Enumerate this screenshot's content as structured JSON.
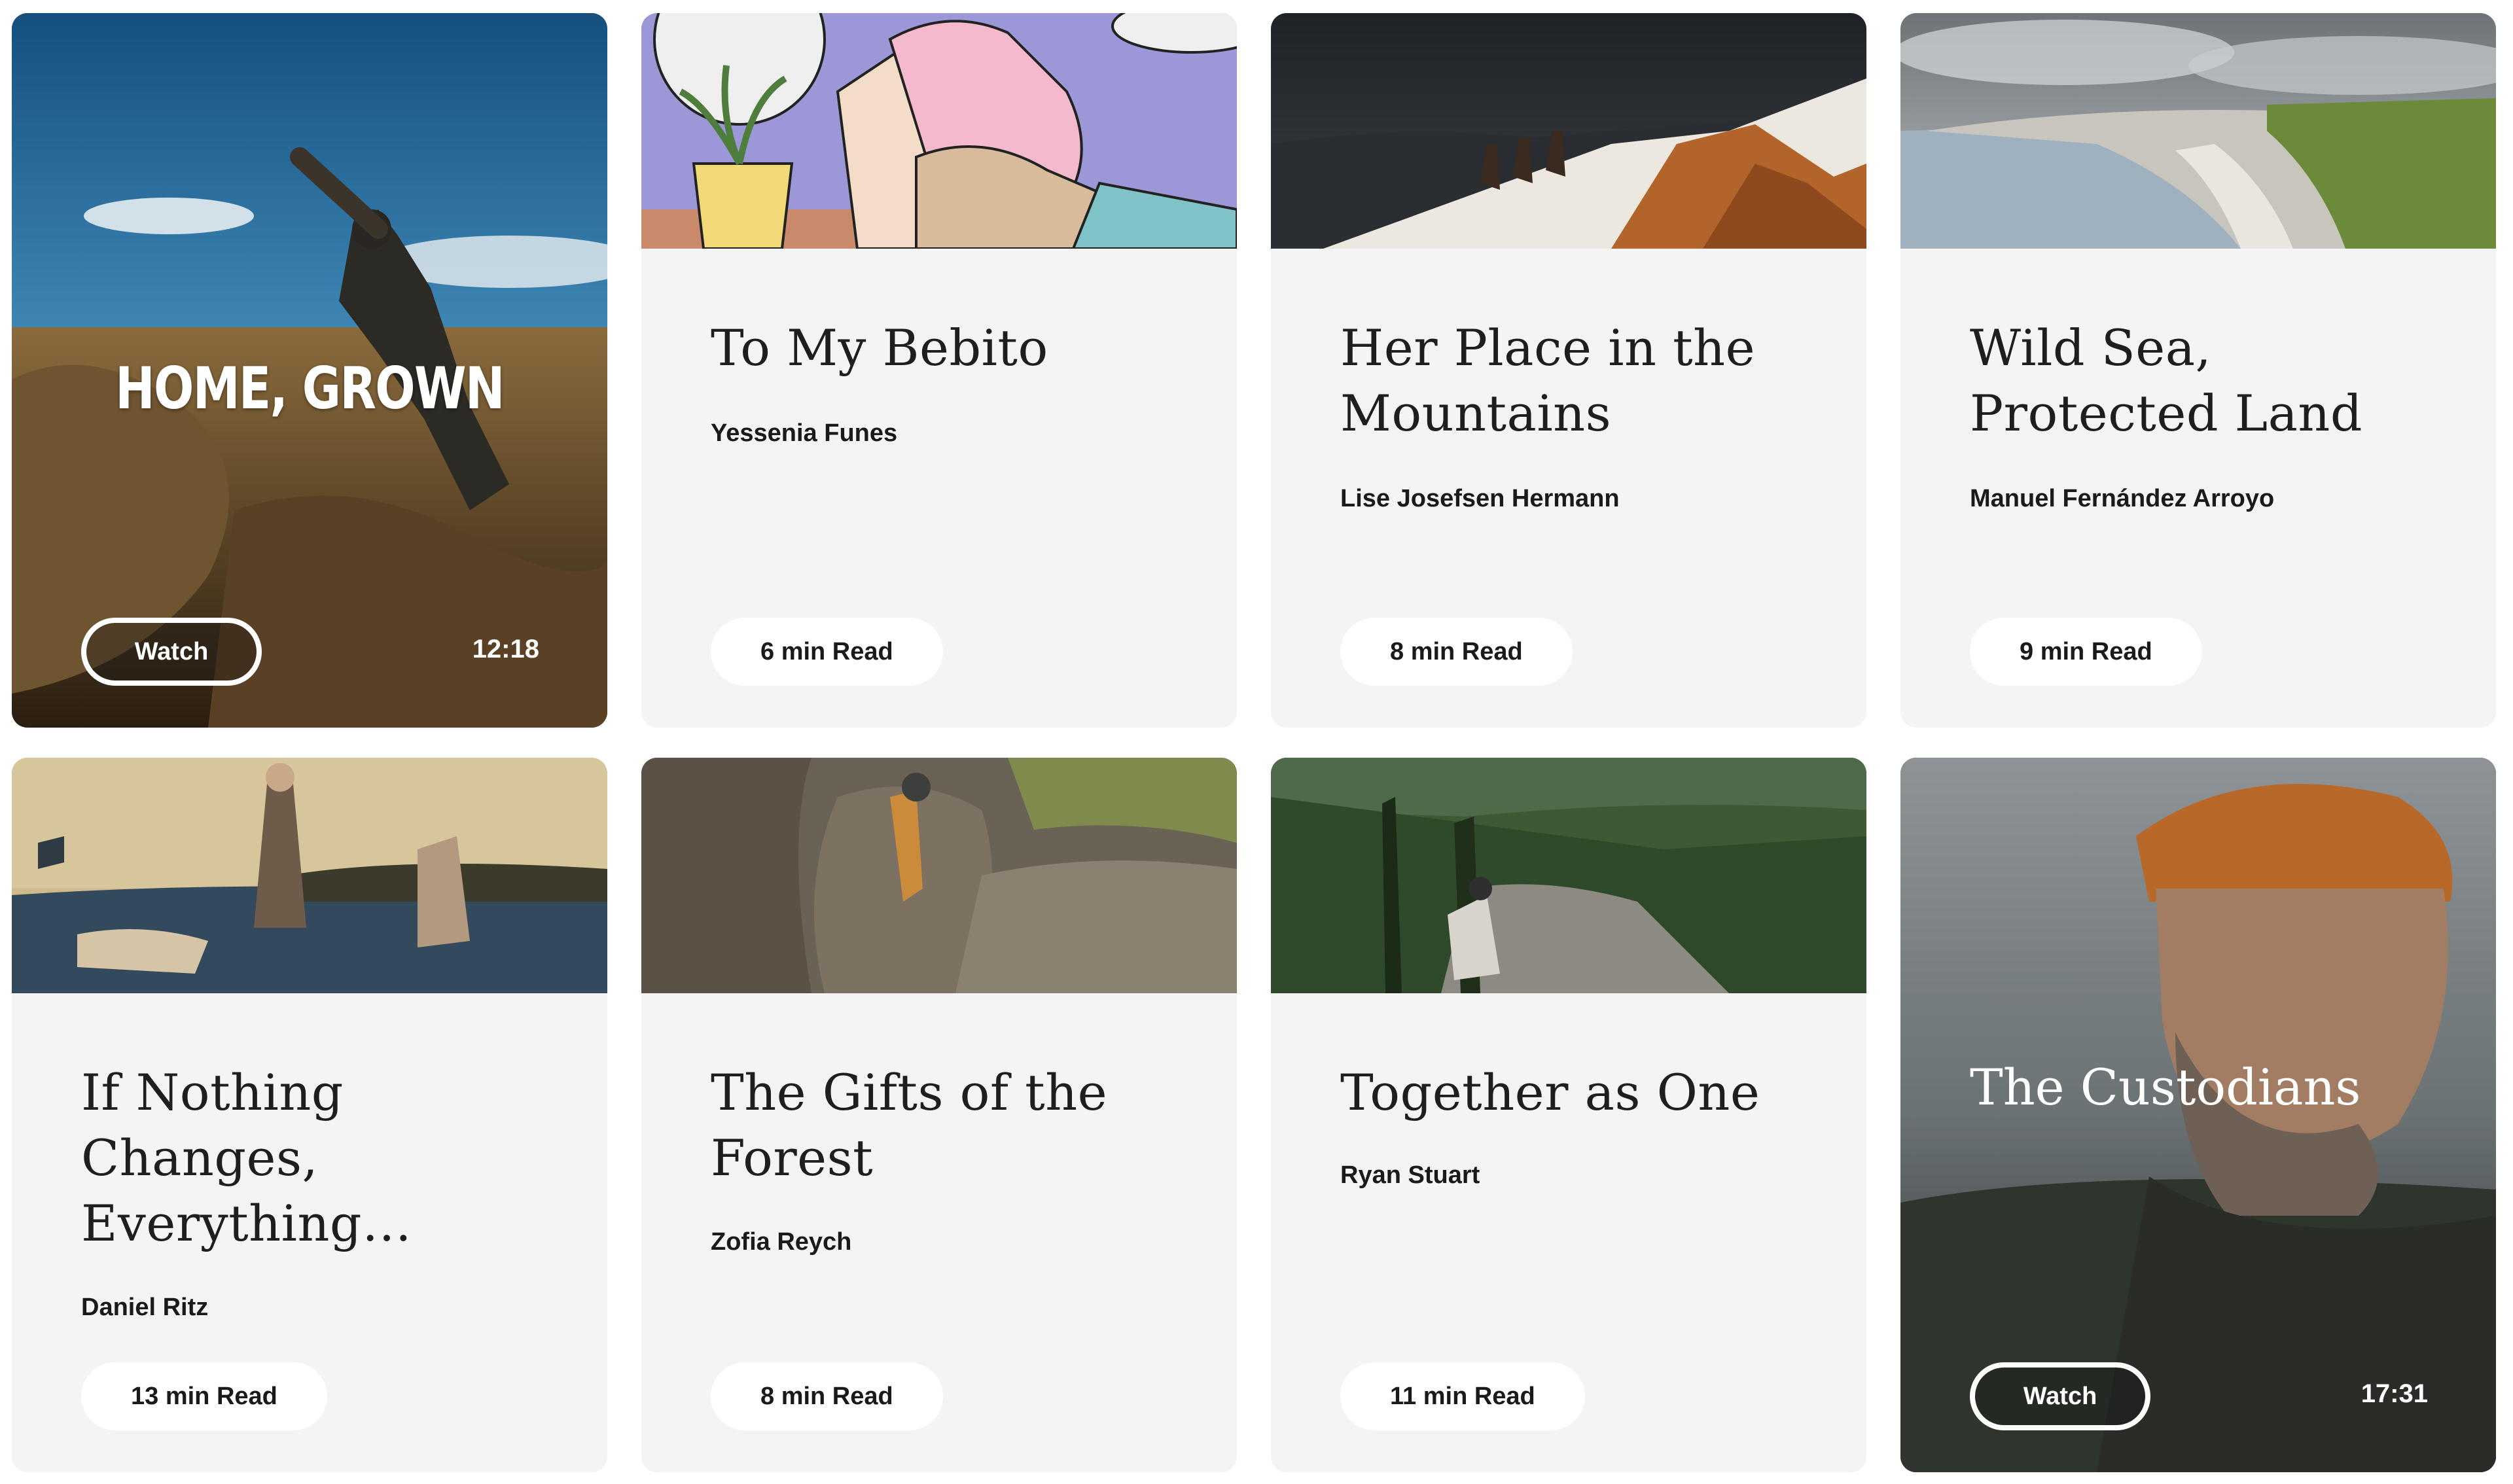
{
  "cards": [
    {
      "id": "home-grown",
      "type": "video",
      "headline": "HOME, GROWN",
      "action": "Watch",
      "duration": "12:18"
    },
    {
      "id": "to-my-bebito",
      "type": "article",
      "title": "To My Bebito",
      "author": "Yessenia Funes",
      "read_time": "6 min Read"
    },
    {
      "id": "her-place",
      "type": "article",
      "title": "Her Place in the Mountains",
      "author": "Lise Josefsen Hermann",
      "read_time": "8 min Read"
    },
    {
      "id": "wild-sea",
      "type": "article",
      "title": "Wild Sea, Protected Land",
      "author": "Manuel Fernández Arroyo",
      "read_time": "9 min Read"
    },
    {
      "id": "if-nothing-changes",
      "type": "article",
      "title": "If Nothing Changes, Everything…",
      "author": "Daniel Ritz",
      "read_time": "13 min Read"
    },
    {
      "id": "gifts-of-forest",
      "type": "article",
      "title": "The Gifts of the Forest",
      "author": "Zofia Reych",
      "read_time": "8 min Read"
    },
    {
      "id": "together-as-one",
      "type": "article",
      "title": "Together as One",
      "author": "Ryan Stuart",
      "read_time": "11 min Read"
    },
    {
      "id": "the-custodians",
      "type": "video",
      "title": "The Custodians",
      "action": "Watch",
      "duration": "17:31"
    }
  ]
}
